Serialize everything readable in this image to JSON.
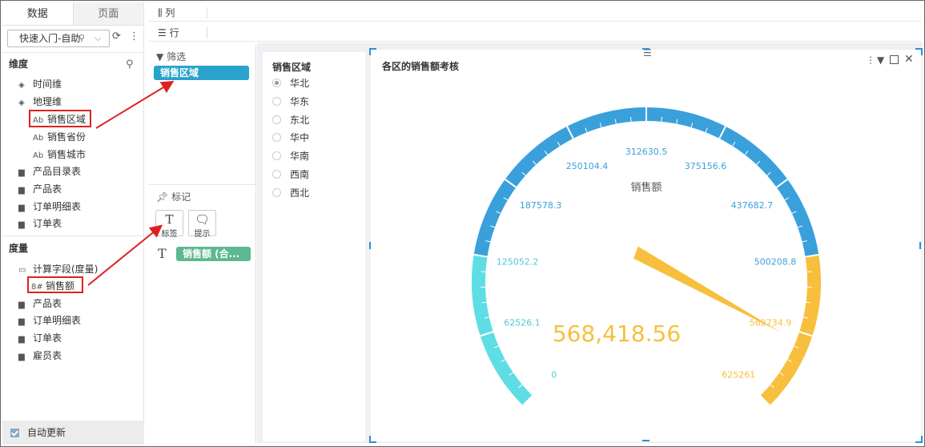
{
  "tabs": {
    "data": "数据",
    "page": "页面"
  },
  "dataset_select": {
    "value": "快速入门-自助"
  },
  "dimensions": {
    "header": "维度",
    "items": [
      {
        "label": "时间维",
        "icon": "layers-icon"
      },
      {
        "label": "地理维",
        "icon": "layers-icon"
      },
      {
        "label": "销售区域",
        "icon": "text-field-icon",
        "prefix": "Ab"
      },
      {
        "label": "销售省份",
        "icon": "text-field-icon",
        "prefix": "Ab"
      },
      {
        "label": "销售城市",
        "icon": "text-field-icon",
        "prefix": "Ab"
      },
      {
        "label": "产品目录表",
        "icon": "folder-icon"
      },
      {
        "label": "产品表",
        "icon": "folder-icon"
      },
      {
        "label": "订单明细表",
        "icon": "folder-icon"
      },
      {
        "label": "订单表",
        "icon": "folder-icon"
      }
    ]
  },
  "measures": {
    "header": "度量",
    "items": [
      {
        "label": "计算字段(度量)",
        "icon": "folder-open-icon"
      },
      {
        "label": "销售额",
        "icon": "numeric-field-icon",
        "prefix": "8#"
      },
      {
        "label": "产品表",
        "icon": "folder-icon"
      },
      {
        "label": "订单明细表",
        "icon": "folder-icon"
      },
      {
        "label": "订单表",
        "icon": "folder-icon"
      },
      {
        "label": "雇员表",
        "icon": "folder-icon"
      }
    ]
  },
  "auto_update": "自动更新",
  "shelves": {
    "columns": "列",
    "rows": "行"
  },
  "filter_section": {
    "header": "筛选",
    "pill": "销售区域"
  },
  "mark_section": {
    "header": "标记",
    "label_btn": "标签",
    "tooltip_btn": "提示",
    "glyph": "T",
    "pill": "销售额 (合..."
  },
  "region_filter": {
    "title": "销售区域",
    "options": [
      "华北",
      "华东",
      "东北",
      "华中",
      "华南",
      "西南",
      "西北"
    ],
    "selected": "华北"
  },
  "chart_data": {
    "type": "gauge",
    "title": "各区的销售额考核",
    "series_name": "销售额",
    "value": 568418.56,
    "value_label": "568,418.56",
    "min": 0,
    "max": 625261,
    "ticks": [
      "0",
      "62526.1",
      "125052.2",
      "187578.3",
      "250104.4",
      "312630.5",
      "375156.6",
      "437682.7",
      "500208.8",
      "562734.9",
      "625261"
    ],
    "bands": [
      {
        "to": 0.2,
        "color": "#5fdde5"
      },
      {
        "to": 0.8,
        "color": "#3aa0dc"
      },
      {
        "to": 1.0,
        "color": "#f7bf3d"
      }
    ],
    "pointer_color": "#f7bf3d"
  },
  "colors": {
    "accent": "#2aa3cc",
    "measure_pill": "#5cb891",
    "red_annotation": "#e02020"
  }
}
